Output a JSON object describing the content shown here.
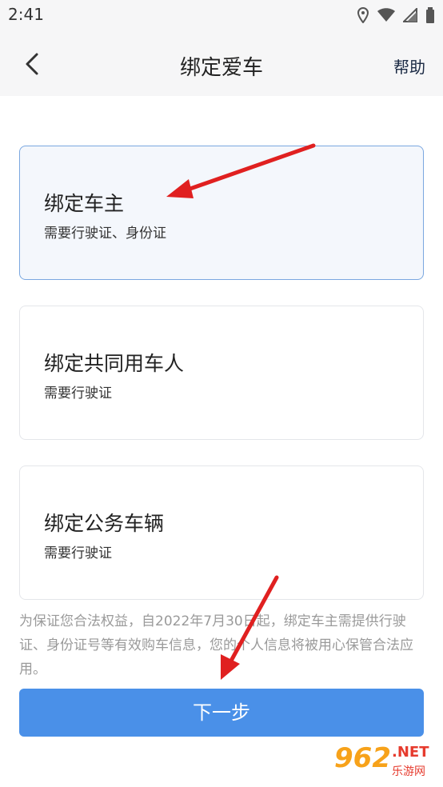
{
  "status_bar": {
    "time": "2:41"
  },
  "nav": {
    "title": "绑定爱车",
    "help": "帮助"
  },
  "options": [
    {
      "title": "绑定车主",
      "subtitle": "需要行驶证、身份证",
      "selected": true
    },
    {
      "title": "绑定共同用车人",
      "subtitle": "需要行驶证",
      "selected": false
    },
    {
      "title": "绑定公务车辆",
      "subtitle": "需要行驶证",
      "selected": false
    }
  ],
  "notice": "为保证您合法权益，自2022年7月30日起，绑定车主需提供行驶证、身份证号等有效购车信息，您的个人信息将被用心保管合法应用。",
  "next_button": "下一步",
  "watermark": {
    "main": "962",
    "net": ".NET",
    "sub": "乐游网"
  },
  "colors": {
    "accent": "#4a90e8",
    "selected_border": "#7aa7e0",
    "annotation_arrow": "#e02020"
  }
}
